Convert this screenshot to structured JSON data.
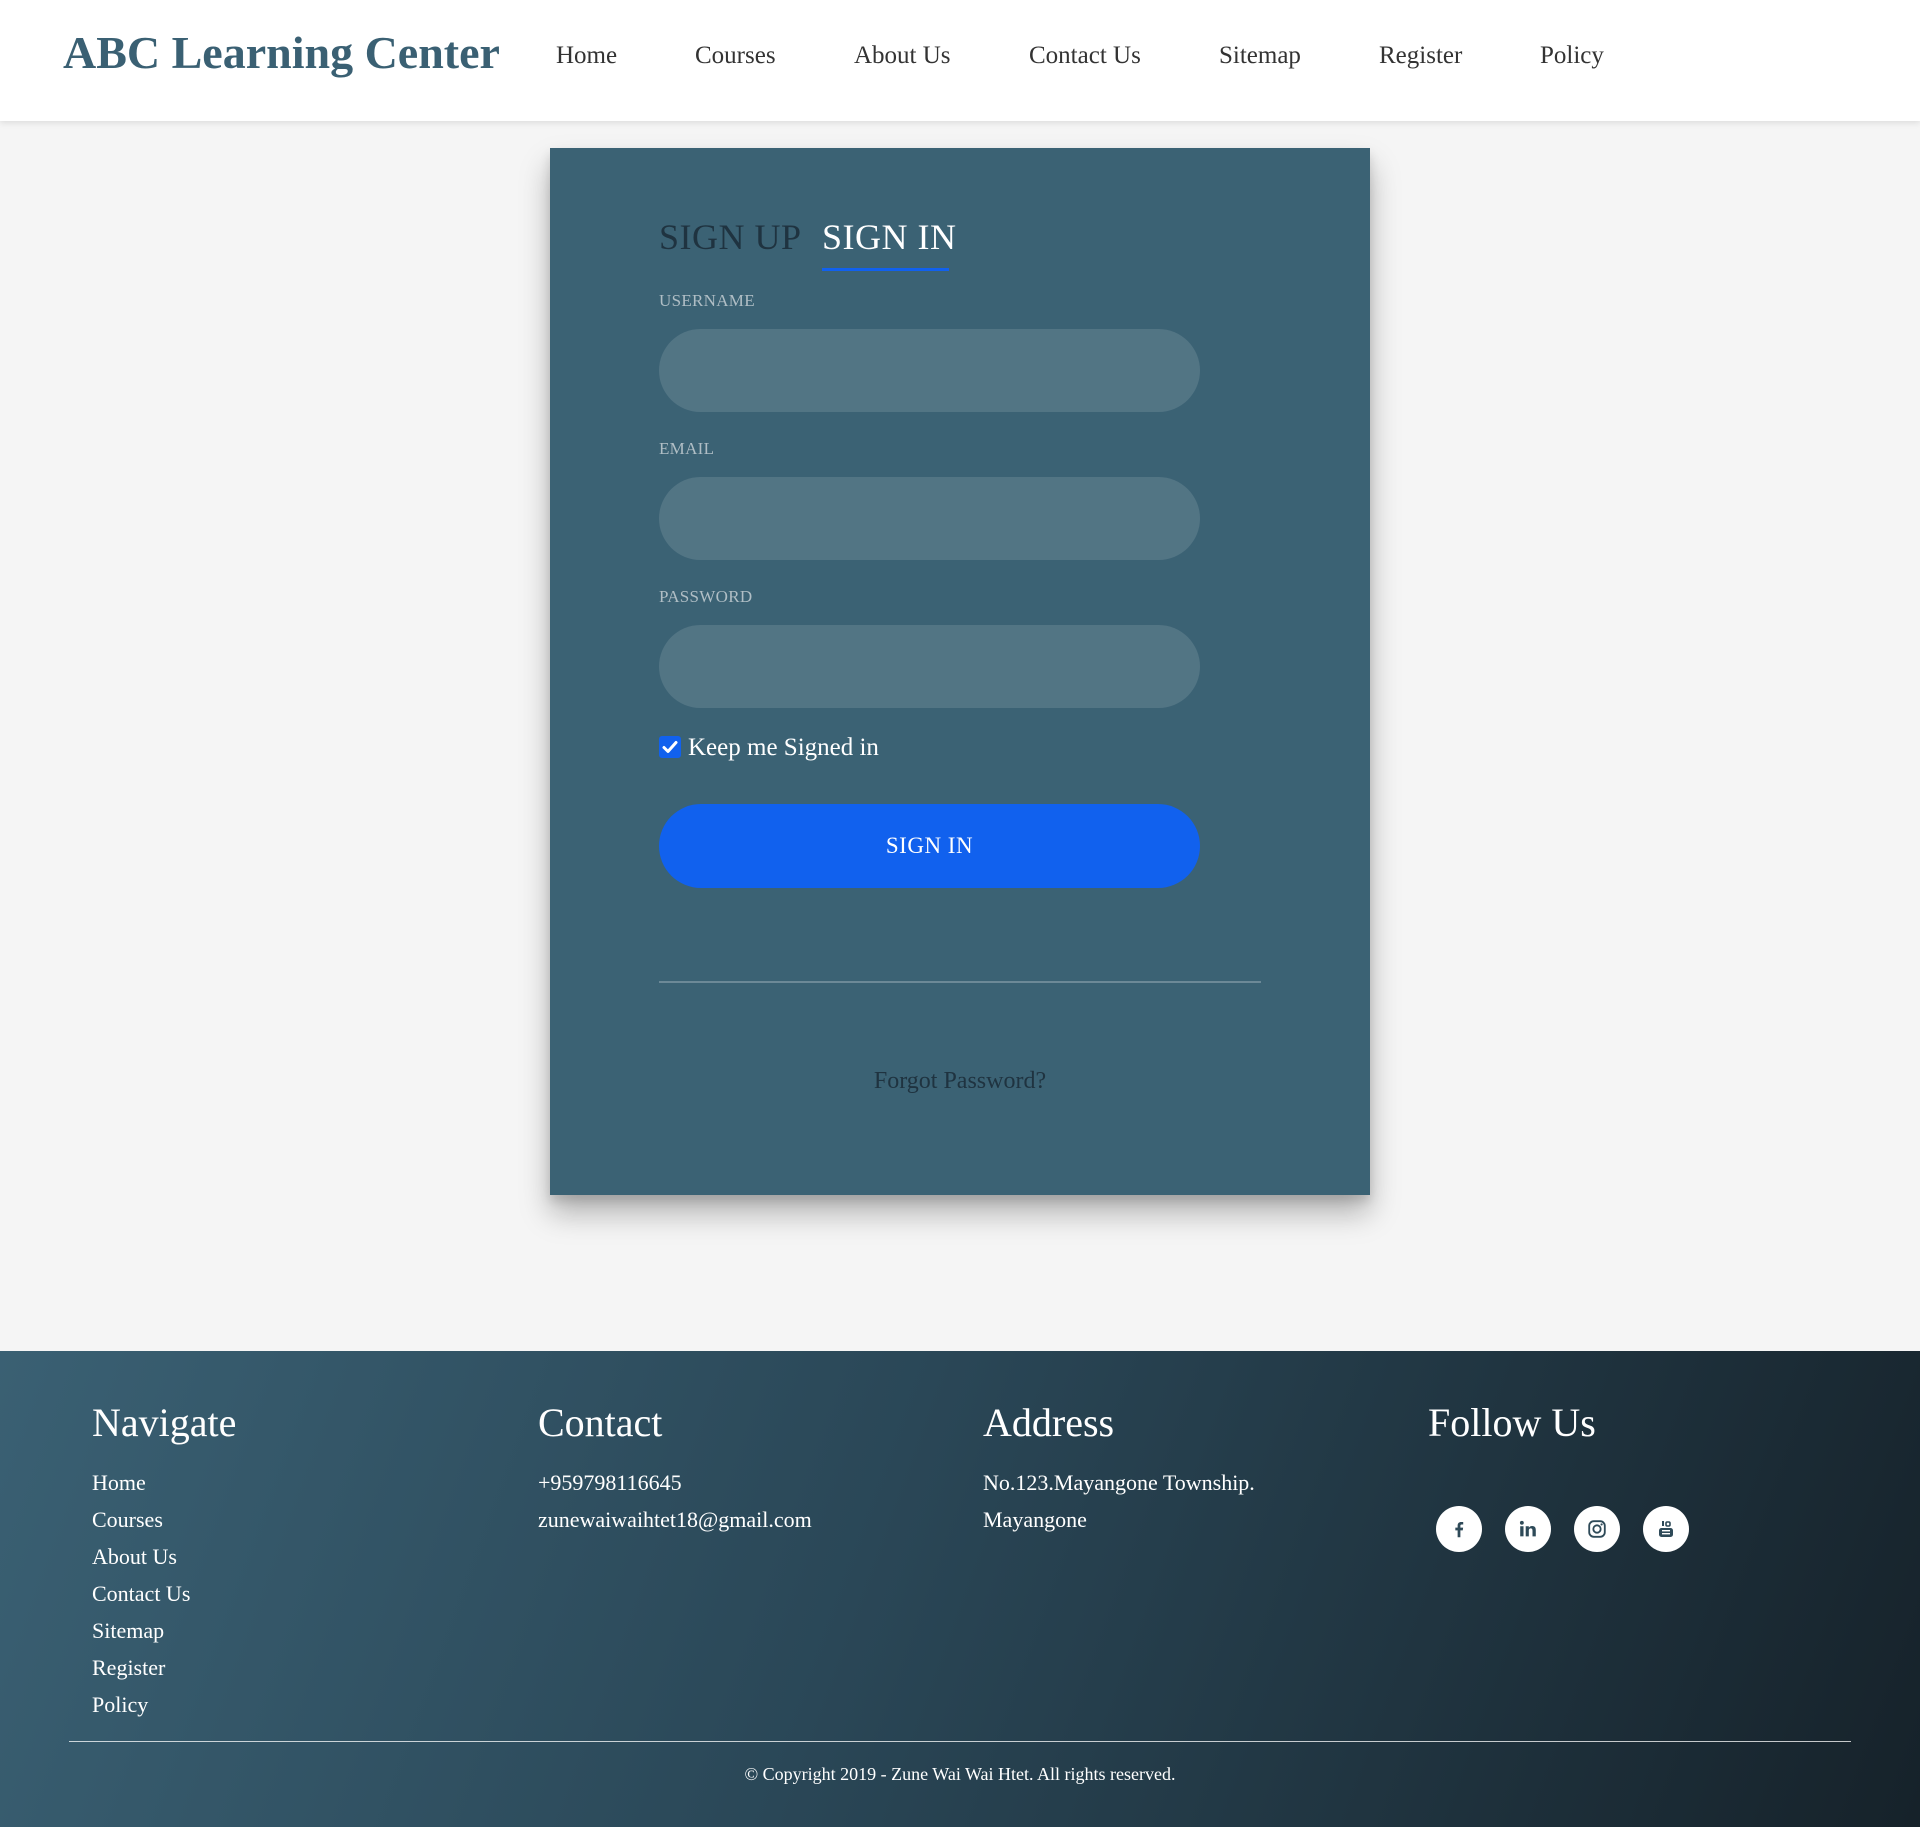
{
  "header": {
    "brand": "ABC Learning Center",
    "nav": [
      "Home",
      "Courses",
      "About Us",
      "Contact Us",
      "Sitemap",
      "Register",
      "Policy"
    ]
  },
  "form": {
    "tabs": {
      "signup": "SIGN UP",
      "signin": "SIGN IN"
    },
    "active_tab": "signin",
    "fields": {
      "username_label": "USERNAME",
      "username_value": "",
      "email_label": "EMAIL",
      "email_value": "",
      "password_label": "PASSWORD",
      "password_value": ""
    },
    "keep_signed_in": {
      "label": "Keep me Signed in",
      "checked": true
    },
    "submit_label": "SIGN IN",
    "forgot_label": "Forgot Password?"
  },
  "footer": {
    "navigate": {
      "title": "Navigate",
      "links": [
        "Home",
        "Courses",
        "About Us",
        "Contact Us",
        "Sitemap",
        "Register",
        "Policy"
      ]
    },
    "contact": {
      "title": "Contact",
      "phone": "+959798116645",
      "email": "zunewaiwaihtet18@gmail.com"
    },
    "address": {
      "title": "Address",
      "line1": "No.123.Mayangone Township.",
      "line2": "Mayangone"
    },
    "follow": {
      "title": "Follow Us",
      "icons": [
        "facebook-icon",
        "linkedin-icon",
        "instagram-icon",
        "youtube-icon"
      ]
    },
    "copyright": "© Copyright 2019 - Zune Wai Wai Htet. All rights reserved."
  },
  "colors": {
    "brand": "#3a6073",
    "card": "#3b6274",
    "accent": "#1161ee",
    "footer_start": "#3a6073",
    "footer_end": "#16222a"
  }
}
